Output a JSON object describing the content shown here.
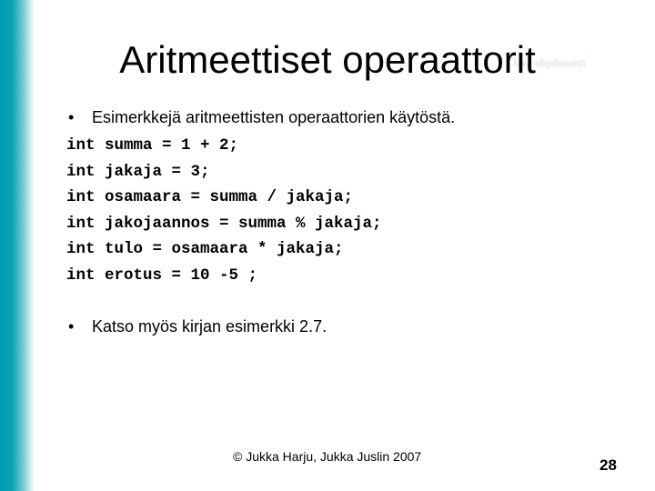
{
  "slide": {
    "accent_color": "#009eae",
    "watermark": "Java-ohjelmointi",
    "title": "Aritmeettiset operaattorit",
    "bullets": [
      "Esimerkkejä aritmeettisten operaattorien käytöstä.",
      "Katso myös kirjan esimerkki 2.7."
    ],
    "bullet_glyph": "•",
    "code_lines": [
      "int summa = 1 + 2;",
      "int jakaja = 3;",
      "int osamaara = summa / jakaja;",
      "int jakojaannos = summa % jakaja;",
      "int tulo = osamaara * jakaja;",
      "int erotus = 10 -5 ;"
    ],
    "footer": "© Jukka Harju, Jukka Juslin 2007",
    "page_number": "28"
  }
}
